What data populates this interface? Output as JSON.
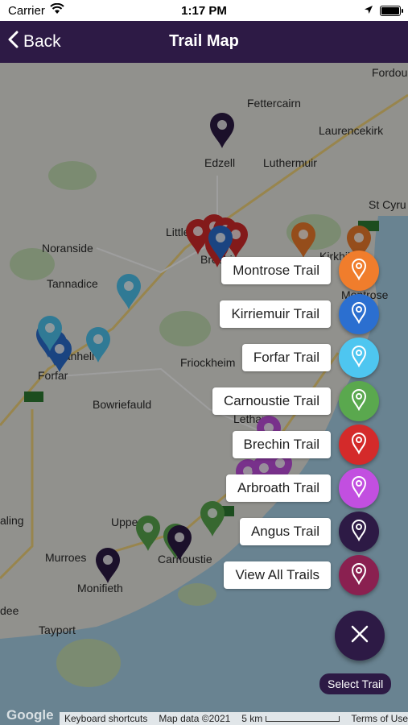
{
  "status_bar": {
    "carrier": "Carrier",
    "time": "1:17 PM"
  },
  "nav": {
    "back_label": "Back",
    "title": "Trail Map"
  },
  "map": {
    "places": [
      {
        "name": "Fettercairn"
      },
      {
        "name": "Fordou"
      },
      {
        "name": "Edzell"
      },
      {
        "name": "Laurencekirk"
      },
      {
        "name": "Luthermuir"
      },
      {
        "name": "St Cyru"
      },
      {
        "name": "Noranside"
      },
      {
        "name": "Little"
      },
      {
        "name": "Brechin"
      },
      {
        "name": "Kirkhil"
      },
      {
        "name": "Tannadice"
      },
      {
        "name": "Montrose"
      },
      {
        "name": "Forfar"
      },
      {
        "name": "Friockheim"
      },
      {
        "name": "Bowriefauld"
      },
      {
        "name": "Letham"
      },
      {
        "name": "aling"
      },
      {
        "name": "Upper"
      },
      {
        "name": "Carnoustie"
      },
      {
        "name": "Murroes"
      },
      {
        "name": "Monifieth"
      },
      {
        "name": "dee"
      },
      {
        "name": "Tayport"
      },
      {
        "name": "hanhell"
      }
    ],
    "road_labels": [
      "A92",
      "A90",
      "A92"
    ]
  },
  "trail_menu": [
    {
      "label": "Montrose Trail",
      "color": "#f07d2c"
    },
    {
      "label": "Kirriemuir Trail",
      "color": "#2b6fd0"
    },
    {
      "label": "Forfar Trail",
      "color": "#4ec6f0"
    },
    {
      "label": "Carnoustie Trail",
      "color": "#5aa84e"
    },
    {
      "label": "Brechin Trail",
      "color": "#d42a2a"
    },
    {
      "label": "Arbroath Trail",
      "color": "#c24fe0"
    },
    {
      "label": "Angus Trail",
      "color": "#2d1a45"
    },
    {
      "label": "View All Trails",
      "color": "#8a2050"
    }
  ],
  "close_button": {
    "icon": "close-icon",
    "color": "#2d1a45"
  },
  "select_trail_label": "Select Trail",
  "footer": {
    "logo": "Google",
    "keyboard_shortcuts": "Keyboard shortcuts",
    "map_data": "Map data ©2021",
    "scale": "5 km",
    "terms": "Terms of Use"
  },
  "pins": [
    {
      "color": "#2d1a45"
    },
    {
      "color": "#d42a2a"
    },
    {
      "color": "#2b6fd0"
    },
    {
      "color": "#4ec6f0"
    },
    {
      "color": "#f07d2c"
    },
    {
      "color": "#5aa84e"
    },
    {
      "color": "#c24fe0"
    }
  ]
}
